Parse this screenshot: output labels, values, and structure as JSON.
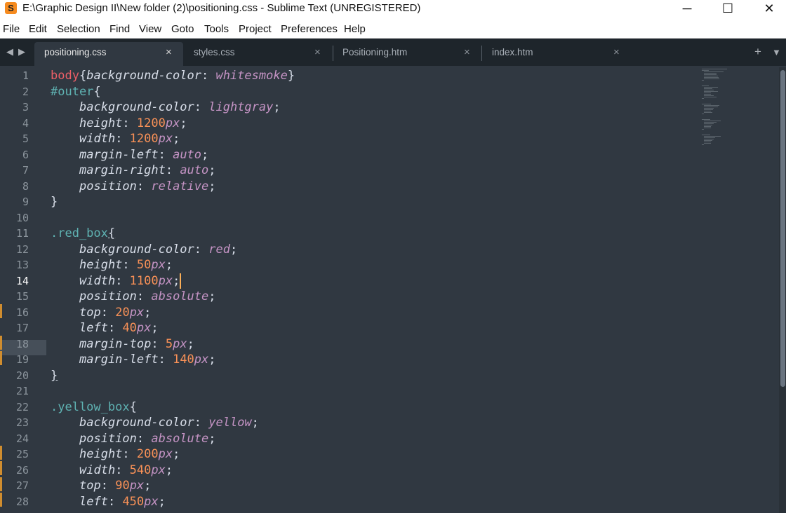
{
  "window": {
    "title": "E:\\Graphic Design II\\New folder (2)\\positioning.css - Sublime Text (UNREGISTERED)",
    "app_icon": "S",
    "controls": [
      "─",
      "☐",
      "✕"
    ]
  },
  "menu": [
    "File",
    "Edit",
    "Selection",
    "Find",
    "View",
    "Goto",
    "Tools",
    "Project",
    "Preferences",
    "Help"
  ],
  "tabs": [
    {
      "label": "positioning.css",
      "active": true
    },
    {
      "label": "styles.css",
      "active": false
    },
    {
      "label": "Positioning.htm",
      "active": false
    },
    {
      "label": "index.htm",
      "active": false
    }
  ],
  "tab_close_glyph": "×",
  "nav": {
    "left": "◀",
    "right": "▶",
    "add": "+",
    "dropdown": "▼"
  },
  "editor": {
    "current_line": 14,
    "modified_lines": [
      16,
      18,
      19,
      25,
      26,
      27,
      28
    ],
    "line_numbers": [
      "1",
      "2",
      "3",
      "4",
      "5",
      "6",
      "7",
      "8",
      "9",
      "10",
      "11",
      "12",
      "13",
      "14",
      "15",
      "16",
      "17",
      "18",
      "19",
      "20",
      "21",
      "22",
      "23",
      "24",
      "25",
      "26",
      "27",
      "28"
    ],
    "code": [
      [
        "body",
        "{",
        "background-color",
        ": ",
        "whitesmoke",
        "}"
      ],
      [
        "#outer",
        "{"
      ],
      [
        "background-color",
        ": ",
        "lightgray",
        ";"
      ],
      [
        "height",
        ": ",
        "1200",
        "px",
        ";"
      ],
      [
        "width",
        ": ",
        "1200",
        "px",
        ";"
      ],
      [
        "margin-left",
        ": ",
        "auto",
        ";"
      ],
      [
        "margin-right",
        ": ",
        "auto",
        ";"
      ],
      [
        "position",
        ": ",
        "relative",
        ";"
      ],
      [
        "}"
      ],
      [
        ""
      ],
      [
        ".red_box",
        "{"
      ],
      [
        "background-color",
        ": ",
        "red",
        ";"
      ],
      [
        "height",
        ": ",
        "50",
        "px",
        ";"
      ],
      [
        "width",
        ": ",
        "1100",
        "px",
        ";"
      ],
      [
        "position",
        ": ",
        "absolute",
        ";"
      ],
      [
        "top",
        ": ",
        "20",
        "px",
        ";"
      ],
      [
        "left",
        ": ",
        "40",
        "px",
        ";"
      ],
      [
        "margin-top",
        ": ",
        "5",
        "px",
        ";"
      ],
      [
        "margin-left",
        ": ",
        "140",
        "px",
        ";"
      ],
      [
        "}"
      ],
      [
        ""
      ],
      [
        ".yellow_box",
        "{"
      ],
      [
        "background-color",
        ": ",
        "yellow",
        ";"
      ],
      [
        "position",
        ": ",
        "absolute",
        ";"
      ],
      [
        "height",
        ": ",
        "200",
        "px",
        ";"
      ],
      [
        "width",
        ": ",
        "540",
        "px",
        ";"
      ],
      [
        "top",
        ": ",
        "90",
        "px",
        ";"
      ],
      [
        "left",
        ": ",
        "450",
        "px",
        ";"
      ]
    ]
  },
  "colors": {
    "background": "#303841",
    "selector": "#ec5f67",
    "keyword_value": "#c594c5",
    "number": "#f99157",
    "class_selector": "#5fb3b3",
    "modified_marker": "#d08d2f"
  }
}
